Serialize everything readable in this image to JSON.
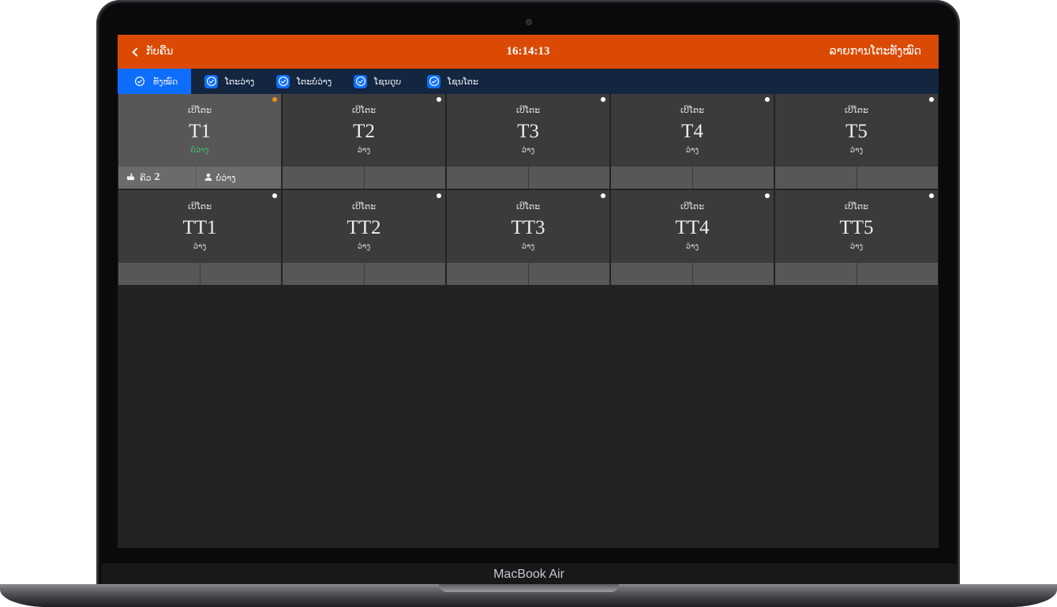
{
  "device": {
    "brand": "MacBook Air"
  },
  "topbar": {
    "back_label": "ກັບຄືນ",
    "clock": "16:14:13",
    "title": "ລາຍການໂຕະທັງໝົດ"
  },
  "tabs": [
    {
      "label": "ທັງໝົດ",
      "active": true
    },
    {
      "label": "ໂຕະວ່າງ",
      "active": false
    },
    {
      "label": "ໂຕະບໍ່ວ່າງ",
      "active": false
    },
    {
      "label": "ໂຊນດູບ",
      "active": false
    },
    {
      "label": "ໂຊນໂຕະ",
      "active": false
    }
  ],
  "tables": [
    {
      "label": "ເບີໂຕະ",
      "name": "T1",
      "status": "ບໍ່ວ່າງ",
      "queue_label": "ຄິວ",
      "queue": "2",
      "person_status": "ບໍ່ວ່າງ"
    },
    {
      "label": "ເບີໂຕະ",
      "name": "T2",
      "status": "ວ່າງ"
    },
    {
      "label": "ເບີໂຕະ",
      "name": "T3",
      "status": "ວ່າງ"
    },
    {
      "label": "ເບີໂຕະ",
      "name": "T4",
      "status": "ວ່າງ"
    },
    {
      "label": "ເບີໂຕະ",
      "name": "T5",
      "status": "ວ່າງ"
    },
    {
      "label": "ເບີໂຕະ",
      "name": "TT1",
      "status": "ວ່າງ"
    },
    {
      "label": "ເບີໂຕະ",
      "name": "TT2",
      "status": "ວ່າງ"
    },
    {
      "label": "ເບີໂຕະ",
      "name": "TT3",
      "status": "ວ່າງ"
    },
    {
      "label": "ເບີໂຕະ",
      "name": "TT4",
      "status": "ວ່າງ"
    },
    {
      "label": "ເບີໂຕະ",
      "name": "TT5",
      "status": "ວ່າງ"
    }
  ],
  "colors": {
    "header": "#db4a04",
    "tabbar": "#13253f",
    "accent": "#0d6efd",
    "busy_status": "#3ec46d",
    "selected_dot": "#f28b16"
  }
}
